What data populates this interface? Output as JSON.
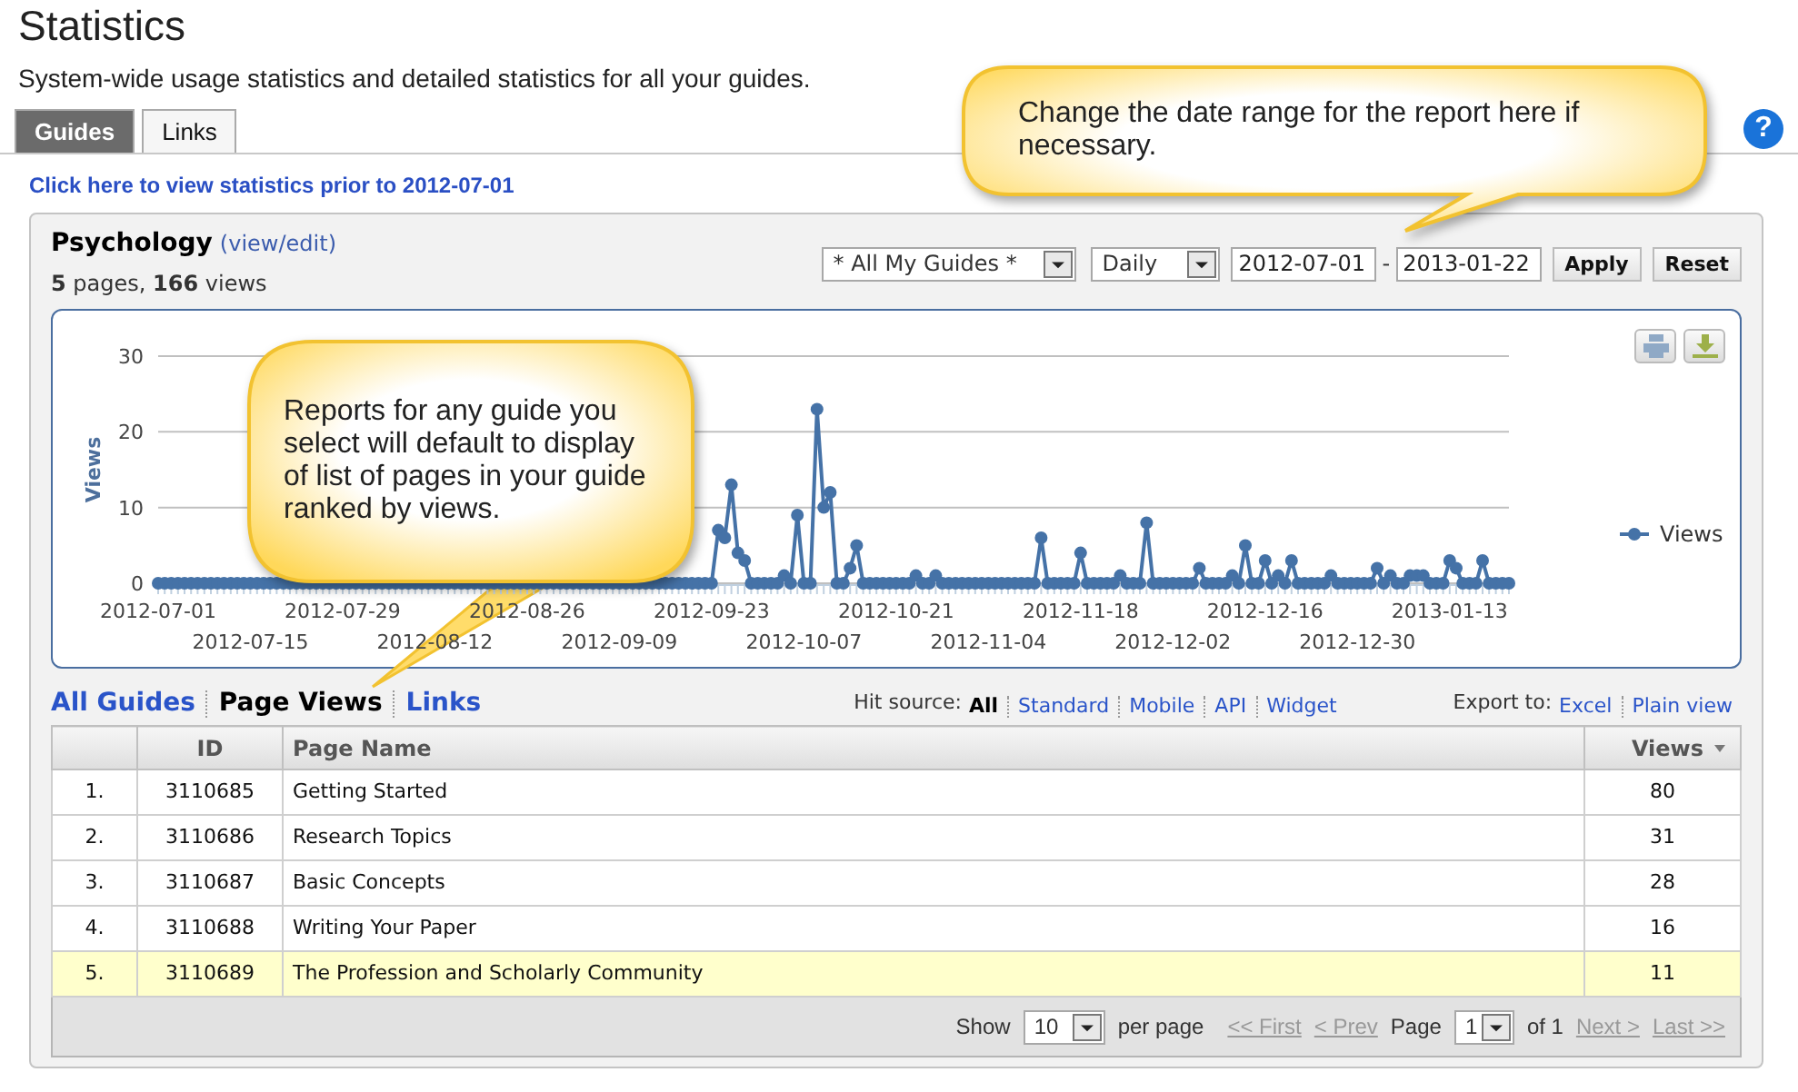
{
  "header": {
    "title": "Statistics",
    "subtitle": "System-wide usage statistics and detailed statistics for all your guides."
  },
  "tabs": [
    {
      "label": "Guides",
      "selected": true
    },
    {
      "label": "Links",
      "selected": false
    }
  ],
  "help": {
    "label": "?"
  },
  "prior_link": "Click here to view statistics prior to 2012-07-01",
  "guide": {
    "name": "Psychology",
    "edit_link": "(view/edit)",
    "summary": "**5** pages, **166** views"
  },
  "filters": {
    "guide_select": "* All My Guides *",
    "interval_select": "Daily",
    "start_date": "2012-07-01",
    "separator": "-",
    "end_date": "2013-01-22",
    "buttons": [
      "Apply",
      "Reset"
    ]
  },
  "chart": {
    "chart_data": {
      "type": "line",
      "ylabel": "Views",
      "ylim": [
        0,
        30
      ],
      "yticks": [
        0,
        10,
        20,
        30
      ],
      "categories": [
        "2012-07-01",
        null,
        null,
        null,
        null,
        null,
        null,
        null,
        null,
        null,
        null,
        null,
        null,
        null,
        "2012-07-15",
        null,
        null,
        null,
        null,
        null,
        null,
        null,
        null,
        null,
        null,
        null,
        null,
        null,
        "2012-07-29",
        null,
        null,
        null,
        null,
        null,
        null,
        null,
        null,
        null,
        null,
        null,
        null,
        null,
        "2012-08-12",
        null,
        null,
        null,
        null,
        null,
        null,
        null,
        null,
        null,
        null,
        null,
        null,
        null,
        "2012-08-26",
        null,
        null,
        null,
        null,
        null,
        null,
        null,
        null,
        null,
        null,
        null,
        null,
        null,
        "2012-09-09",
        null,
        null,
        null,
        null,
        null,
        null,
        null,
        null,
        null,
        null,
        null,
        null,
        null,
        "2012-09-23",
        null,
        null,
        null,
        null,
        null,
        null,
        null,
        null,
        null,
        null,
        null,
        null,
        null,
        "2012-10-07",
        null,
        null,
        null,
        null,
        null,
        null,
        null,
        null,
        null,
        null,
        null,
        null,
        null,
        "2012-10-21",
        null,
        null,
        null,
        null,
        null,
        null,
        null,
        null,
        null,
        null,
        null,
        null,
        null,
        "2012-11-04",
        null,
        null,
        null,
        null,
        null,
        null,
        null,
        null,
        null,
        null,
        null,
        null,
        null,
        "2012-11-18",
        null,
        null,
        null,
        null,
        null,
        null,
        null,
        null,
        null,
        null,
        null,
        null,
        null,
        "2012-12-02",
        null,
        null,
        null,
        null,
        null,
        null,
        null,
        null,
        null,
        null,
        null,
        null,
        null,
        "2012-12-16",
        null,
        null,
        null,
        null,
        null,
        null,
        null,
        null,
        null,
        null,
        null,
        null,
        null,
        "2012-12-30",
        null,
        null,
        null,
        null,
        null,
        null,
        null,
        null,
        null,
        null,
        null,
        null,
        null,
        "2013-01-13",
        null,
        null,
        null,
        null,
        null,
        null,
        null,
        null,
        null
      ],
      "series": [
        {
          "name": "Views",
          "color": "#4572a7",
          "marker": "circle",
          "values": [
            0,
            0,
            0,
            0,
            0,
            0,
            0,
            0,
            0,
            0,
            0,
            0,
            0,
            0,
            0,
            0,
            0,
            0,
            0,
            0,
            0,
            0,
            0,
            0,
            0,
            0,
            0,
            0,
            0,
            0,
            0,
            0,
            0,
            0,
            0,
            0,
            0,
            0,
            0,
            0,
            0,
            0,
            0,
            0,
            0,
            0,
            0,
            0,
            0,
            0,
            0,
            0,
            0,
            0,
            0,
            0,
            0,
            0,
            0,
            0,
            0,
            0,
            0,
            0,
            0,
            0,
            0,
            0,
            0,
            0,
            0,
            0,
            0,
            0,
            0,
            0,
            0,
            0,
            0,
            0,
            0,
            0,
            0,
            0,
            0,
            7,
            6,
            13,
            4,
            3,
            0,
            0,
            0,
            0,
            0,
            1,
            0,
            9,
            0,
            0,
            23,
            10,
            12,
            0,
            0,
            2,
            5,
            0,
            0,
            0,
            0,
            0,
            0,
            0,
            0,
            1,
            0,
            0,
            1,
            0,
            0,
            0,
            0,
            0,
            0,
            0,
            0,
            0,
            0,
            0,
            0,
            0,
            0,
            0,
            6,
            0,
            0,
            0,
            0,
            0,
            4,
            0,
            0,
            0,
            0,
            0,
            1,
            0,
            0,
            0,
            8,
            0,
            0,
            0,
            0,
            0,
            0,
            0,
            2,
            0,
            0,
            0,
            0,
            1,
            0,
            5,
            0,
            0,
            3,
            0,
            1,
            0,
            3,
            0,
            0,
            0,
            0,
            0,
            1,
            0,
            0,
            0,
            0,
            0,
            0,
            2,
            0,
            1,
            0,
            0,
            1,
            1,
            1,
            0,
            0,
            0,
            3,
            2,
            0,
            0,
            0,
            3,
            0,
            0,
            0,
            0
          ]
        }
      ]
    }
  },
  "views": [
    {
      "label": "All Guides",
      "selected": false
    },
    {
      "label": "Page Views",
      "selected": true
    },
    {
      "label": "Links",
      "selected": false
    }
  ],
  "hit_source": {
    "label": "Hit source:",
    "options": [
      {
        "label": "All",
        "selected": true
      },
      {
        "label": "Standard",
        "selected": false
      },
      {
        "label": "Mobile",
        "selected": false
      },
      {
        "label": "API",
        "selected": false
      },
      {
        "label": "Widget",
        "selected": false
      }
    ]
  },
  "export": {
    "label": "Export to:",
    "links": [
      "Excel",
      "Plain view"
    ]
  },
  "table": {
    "columns": [
      {
        "label": "ID",
        "sorted": false
      },
      {
        "label": "Page Name",
        "sorted": false
      },
      {
        "label": "Views",
        "sorted": true
      }
    ],
    "rows": [
      {
        "rank": "1.",
        "id": "3110685",
        "name": "Getting Started",
        "views": "80",
        "highlighted": false
      },
      {
        "rank": "2.",
        "id": "3110686",
        "name": "Research Topics",
        "views": "31",
        "highlighted": false
      },
      {
        "rank": "3.",
        "id": "3110687",
        "name": "Basic Concepts",
        "views": "28",
        "highlighted": false
      },
      {
        "rank": "4.",
        "id": "3110688",
        "name": "Writing Your Paper",
        "views": "16",
        "highlighted": false
      },
      {
        "rank": "5.",
        "id": "3110689",
        "name": "The Profession and Scholarly Community",
        "views": "11",
        "highlighted": true
      }
    ]
  },
  "pagination": {
    "show_label": "Show",
    "per_page_value": "10",
    "per_page_label": "per page",
    "first": "<< First",
    "prev": "< Prev",
    "page_label": "Page",
    "page_value": "1",
    "of_label": "of 1",
    "next": "Next >",
    "last": "Last >>",
    "first_disabled": true,
    "prev_disabled": true,
    "next_disabled": true,
    "last_disabled": true
  },
  "callouts": [
    {
      "text": "Change the date range for the report here if necessary."
    },
    {
      "text": "Reports for any guide you select will default to display of list of pages in your guide ranked by views."
    }
  ]
}
